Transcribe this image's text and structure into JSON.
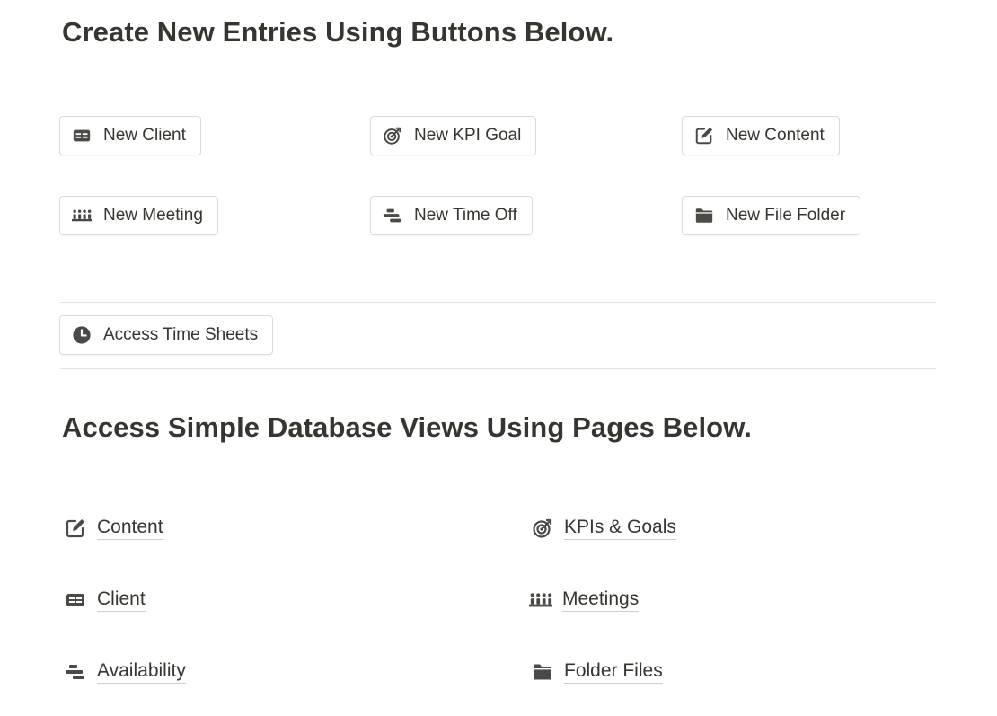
{
  "sections": {
    "create_heading": "Create New Entries Using Buttons Below.",
    "access_heading": "Access Simple Database Views Using Pages Below."
  },
  "buttons": {
    "new_client": {
      "label": "New Client",
      "icon": "client-card-icon"
    },
    "new_kpi_goal": {
      "label": "New KPI Goal",
      "icon": "target-icon"
    },
    "new_content": {
      "label": "New Content",
      "icon": "edit-icon"
    },
    "new_meeting": {
      "label": "New Meeting",
      "icon": "meeting-icon"
    },
    "new_time_off": {
      "label": "New Time Off",
      "icon": "timeline-icon"
    },
    "new_file_folder": {
      "label": "New File Folder",
      "icon": "folder-icon"
    },
    "access_time_sheets": {
      "label": "Access Time Sheets",
      "icon": "clock-icon"
    }
  },
  "pages": {
    "content": {
      "label": "Content",
      "icon": "edit-icon"
    },
    "kpis_goals": {
      "label": "KPIs & Goals",
      "icon": "target-icon"
    },
    "client": {
      "label": "Client",
      "icon": "client-card-icon"
    },
    "meetings": {
      "label": "Meetings",
      "icon": "meeting-icon"
    },
    "availability": {
      "label": "Availability",
      "icon": "timeline-icon"
    },
    "folder_files": {
      "label": "Folder Files",
      "icon": "folder-icon"
    }
  },
  "colors": {
    "text": "#37352f",
    "icon": "#4b4a46",
    "border": "#dcdbd8",
    "divider": "#e3e2df"
  }
}
